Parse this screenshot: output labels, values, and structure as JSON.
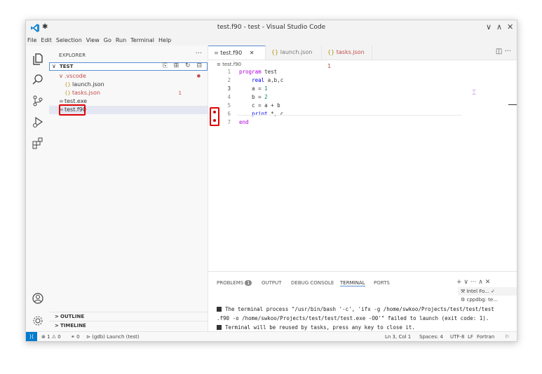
{
  "window": {
    "title": "test.f90 - test - Visual Studio Code",
    "pin_icon": "✱",
    "controls": [
      "∨",
      "∧",
      "✕"
    ]
  },
  "menu": [
    "File",
    "Edit",
    "Selection",
    "View",
    "Go",
    "Run",
    "Terminal",
    "Help"
  ],
  "activity_icons": [
    "files-icon",
    "search-icon",
    "source-control-icon",
    "run-debug-icon",
    "extensions-icon",
    "account-icon",
    "settings-gear-icon"
  ],
  "explorer": {
    "title": "EXPLORER",
    "more": "···",
    "folder": "TEST",
    "folder_actions": "⎘ ⊞ ↻ ⊟",
    "items": [
      {
        "label": ".vscode",
        "prefix": "∨",
        "color": "#c14a4a",
        "badge": "●"
      },
      {
        "label": "launch.json",
        "prefix": "{}",
        "color": "#333333",
        "badge": ""
      },
      {
        "label": "tasks.json",
        "prefix": "{}",
        "color": "#c14a4a",
        "badge": "1"
      },
      {
        "label": "test.exe",
        "prefix": "≡",
        "color": "#333333",
        "badge": ""
      },
      {
        "label": "test.f90",
        "prefix": "≡",
        "color": "#333333",
        "badge": ""
      }
    ],
    "outline": "OUTLINE",
    "timeline": "TIMELINE",
    "chevron": ">"
  },
  "tabs": [
    {
      "icon": "≡",
      "label": "test.f90",
      "close": "✕"
    },
    {
      "icon": "{}",
      "label": "launch.json"
    },
    {
      "icon": "{}",
      "label": "tasks.json",
      "badge": "1"
    }
  ],
  "editor_actions": "◫ ···",
  "breadcrumb": "≡ test.f90",
  "code": [
    {
      "n": "1",
      "html": "<span class='kw'>program</span> test"
    },
    {
      "n": "2",
      "html": "    <span class='kw2'>real</span> a,b,c"
    },
    {
      "n": "3",
      "html": "    a = <span class='num'>1</span>"
    },
    {
      "n": "4",
      "html": "    b = <span class='num'>2</span>"
    },
    {
      "n": "5",
      "html": "    c = a + b"
    },
    {
      "n": "6",
      "html": "    <span class='kw2'>print</span> *, c"
    },
    {
      "n": "7",
      "html": "<span class='kw'>end</span>"
    }
  ],
  "panel": {
    "tabs": [
      "PROBLEMS",
      "OUTPUT",
      "DEBUG CONSOLE",
      "TERMINAL",
      "PORTS"
    ],
    "problems_count": "1",
    "actions": "+ ∨ ··· ∧ ✕",
    "terminal_line1": "The terminal process \"/usr/bin/bash '-c', 'ifx -g /home/swkoo/Projects/test/test/test",
    "terminal_line2": ".f90 -o /home/swkoo/Projects/test/test/test.exe -O0'\" failed to launch (exit code: 1).",
    "terminal_line3": "Terminal will be reused by tasks, press any key to close it.",
    "terminals": [
      "Intel Fo... ✓",
      "cppdbg: te..."
    ]
  },
  "status": {
    "remote": "⟩⟨",
    "problems": "⊗ 1 ⚠ 0",
    "ports": "⚭ 0",
    "debug": "⊳ (gdb) Launch (test)",
    "position": "Ln 3, Col 1",
    "spaces": "Spaces: 4",
    "encoding": "UTF-8",
    "eol": "LF",
    "language": "Fortran",
    "bell": "⚐"
  },
  "colors": {
    "accent": "#007acc",
    "highlight_box": "#e00000",
    "selection": "#e4e6f1"
  }
}
